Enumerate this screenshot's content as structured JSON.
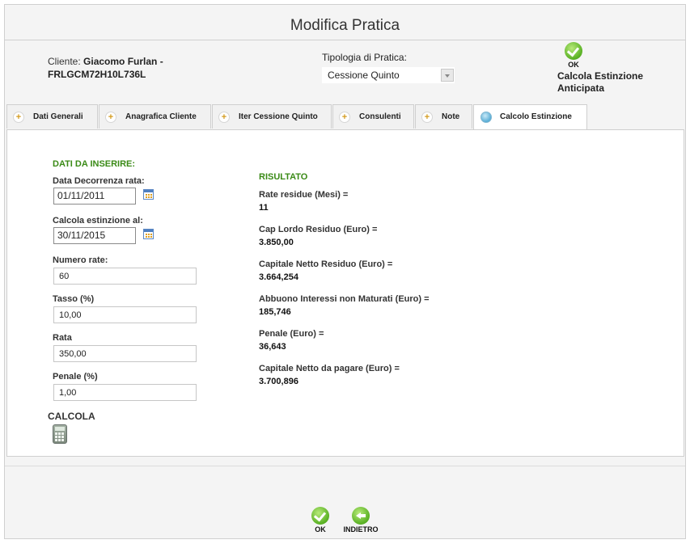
{
  "header": {
    "title": "Modifica Pratica"
  },
  "client": {
    "label": "Cliente:",
    "name": "Giacomo Furlan -",
    "code": "FRLGCM72H10L736L"
  },
  "tipologia": {
    "label": "Tipologia di Pratica:",
    "selected": "Cessione Quinto"
  },
  "top_action": {
    "ok_caption": "OK",
    "line1": "Calcola Estinzione",
    "line2": "Anticipata"
  },
  "tabs": [
    {
      "label": "Dati Generali"
    },
    {
      "label": "Anagrafica Cliente"
    },
    {
      "label": "Iter Cessione Quinto"
    },
    {
      "label": "Consulenti"
    },
    {
      "label": "Note"
    },
    {
      "label": "Calcolo Estinzione",
      "active": true
    }
  ],
  "form": {
    "section_title": "DATI DA INSERIRE:",
    "data_decorrenza": {
      "label": "Data Decorrenza rata:",
      "value": "01/11/2011"
    },
    "calcola_al": {
      "label": "Calcola estinzione al:",
      "value": "30/11/2015"
    },
    "numero_rate": {
      "label": "Numero rate:",
      "value": "60"
    },
    "tasso": {
      "label": "Tasso (%)",
      "value": "10,00"
    },
    "rata": {
      "label": "Rata",
      "value": "350,00"
    },
    "penale": {
      "label": "Penale (%)",
      "value": "1,00"
    },
    "calcola_label": "CALCOLA"
  },
  "result": {
    "section_title": "RISULTATO",
    "items": [
      {
        "label": "Rate residue (Mesi) =",
        "value": "11"
      },
      {
        "label": "Cap Lordo Residuo (Euro) =",
        "value": "3.850,00"
      },
      {
        "label": "Capitale Netto Residuo (Euro) =",
        "value": "3.664,254"
      },
      {
        "label": "Abbuono Interessi non Maturati (Euro) =",
        "value": "185,746"
      },
      {
        "label": "Penale (Euro) =",
        "value": "36,643"
      },
      {
        "label": "Capitale Netto da pagare (Euro) =",
        "value": "3.700,896"
      }
    ]
  },
  "footer": {
    "ok_caption": "OK",
    "back_caption": "INDIETRO"
  },
  "icons": {
    "ok": "checkmark-icon",
    "back": "arrow-left-icon",
    "calendar": "calendar-icon",
    "calculator": "calculator-icon",
    "tab_plus": "plus-icon",
    "tab_active": "circle-icon"
  },
  "colors": {
    "section_green": "#3a8a16",
    "icon_green": "#58b023",
    "tab_plus_orange": "#d49b1e"
  }
}
